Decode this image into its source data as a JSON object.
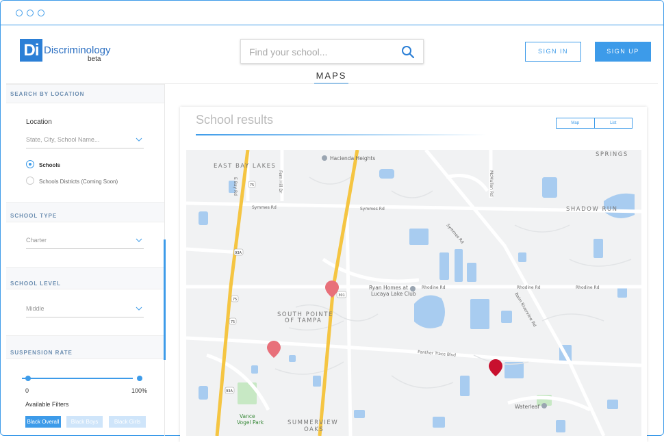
{
  "app": {
    "logo_mark": "Di",
    "logo_name": "Discriminology",
    "logo_tag": "beta"
  },
  "header": {
    "search_placeholder": "Find your school...",
    "sign_in": "SIGN IN",
    "sign_up": "SIGN UP",
    "tab": "MAPS"
  },
  "sidebar": {
    "location_header": "SEARCH BY LOCATION",
    "location_label": "Location",
    "location_placeholder": "State, City, School Name...",
    "radio_schools": "Schools",
    "radio_districts": "Schools Districts (Coming Soon)",
    "school_type_header": "SCHOOL TYPE",
    "school_type_value": "Charter",
    "school_level_header": "SCHOOL LEVEL",
    "school_level_value": "Middle",
    "suspension_header": "SUSPENSION RATE",
    "slider_min": "0",
    "slider_max": "100%",
    "available_filters": "Available Filters",
    "chips": [
      "Black Overall",
      "Black Boys",
      "Black Girls"
    ]
  },
  "main": {
    "title": "School results",
    "toggle_map": "Map",
    "toggle_list": "List"
  },
  "map": {
    "labels": {
      "east_bay_lakes": "EAST BAY LAKES",
      "springs": "SPRINGS",
      "shadow_run": "SHADOW RUN",
      "south_pointe": "SOUTH POINTE",
      "of_tampa": "OF TAMPA",
      "summerview": "SUMMERVIEW",
      "oaks": "OAKS",
      "hacienda": "Hacienda Heights",
      "ryan1": "Ryan Homes at",
      "ryan2": "Lucaya Lake Club",
      "waterleaf": "Waterleaf",
      "vance1": "Vance",
      "vance2": "Vogel Park",
      "symmes1": "Symmes Rd",
      "symmes2": "Symmes Rd",
      "symmes3": "Symmes Rd",
      "rhodine1": "Rhodine Rd",
      "rhodine2": "Rhodine Rd",
      "rhodine3": "Rhodine Rd",
      "panther": "Panther Trace Blvd",
      "balm": "Balm Riverview Rd",
      "mcmullen": "McMullen Rd",
      "fern": "Fern Hill Dr",
      "ebay": "E Bay Rd",
      "r75a": "75",
      "r75b": "75",
      "r75c": "75",
      "r301": "301",
      "r93a": "93A",
      "r93b": "93A"
    },
    "colors": {
      "highway": "#f5c542",
      "marker_active": "#c8102e",
      "marker": "#e8707a",
      "water": "#a8ccf0",
      "park": "#c7e8c4"
    }
  }
}
